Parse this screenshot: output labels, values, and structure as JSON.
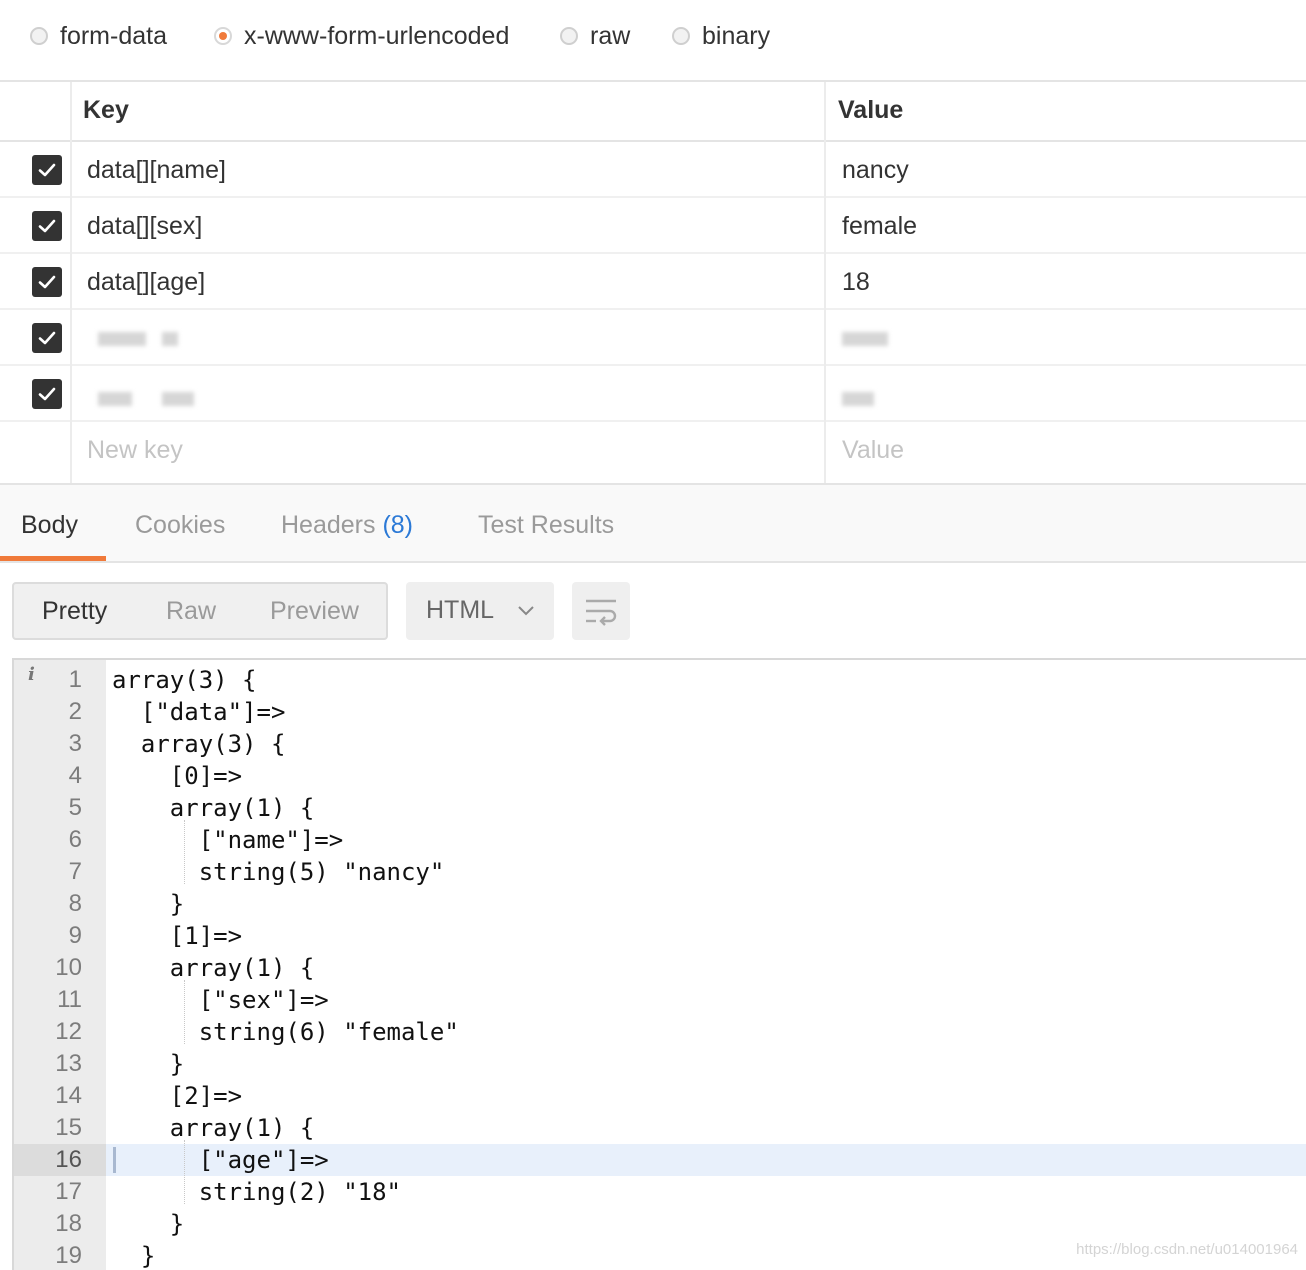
{
  "body_types": [
    {
      "label": "form-data",
      "selected": false
    },
    {
      "label": "x-www-form-urlencoded",
      "selected": true
    },
    {
      "label": "raw",
      "selected": false
    },
    {
      "label": "binary",
      "selected": false
    }
  ],
  "params_table": {
    "key_header": "Key",
    "value_header": "Value",
    "rows": [
      {
        "key": "data[][name]",
        "value": "nancy",
        "checked": true
      },
      {
        "key": "data[][sex]",
        "value": "female",
        "checked": true
      },
      {
        "key": "data[][age]",
        "value": "18",
        "checked": true
      }
    ],
    "new_key_placeholder": "New key",
    "new_value_placeholder": "Value"
  },
  "response_tabs": {
    "body": "Body",
    "cookies": "Cookies",
    "headers": "Headers",
    "headers_count": "(8)",
    "test_results": "Test Results"
  },
  "view_modes": {
    "pretty": "Pretty",
    "raw": "Raw",
    "preview": "Preview"
  },
  "format_dropdown": {
    "selected": "HTML"
  },
  "code_lines": [
    "array(3) {",
    "  [\"data\"]=>",
    "  array(3) {",
    "    [0]=>",
    "    array(1) {",
    "      [\"name\"]=>",
    "      string(5) \"nancy\"",
    "    }",
    "    [1]=>",
    "    array(1) {",
    "      [\"sex\"]=>",
    "      string(6) \"female\"",
    "    }",
    "    [2]=>",
    "    array(1) {",
    "      [\"age\"]=>",
    "      string(2) \"18\"",
    "    }",
    "  }"
  ],
  "highlighted_line": 16,
  "watermark": "https://blog.csdn.net/u014001964",
  "colors": {
    "accent": "#f07a3a",
    "link": "#2b79d6",
    "highlight": "#e8f0fb"
  }
}
